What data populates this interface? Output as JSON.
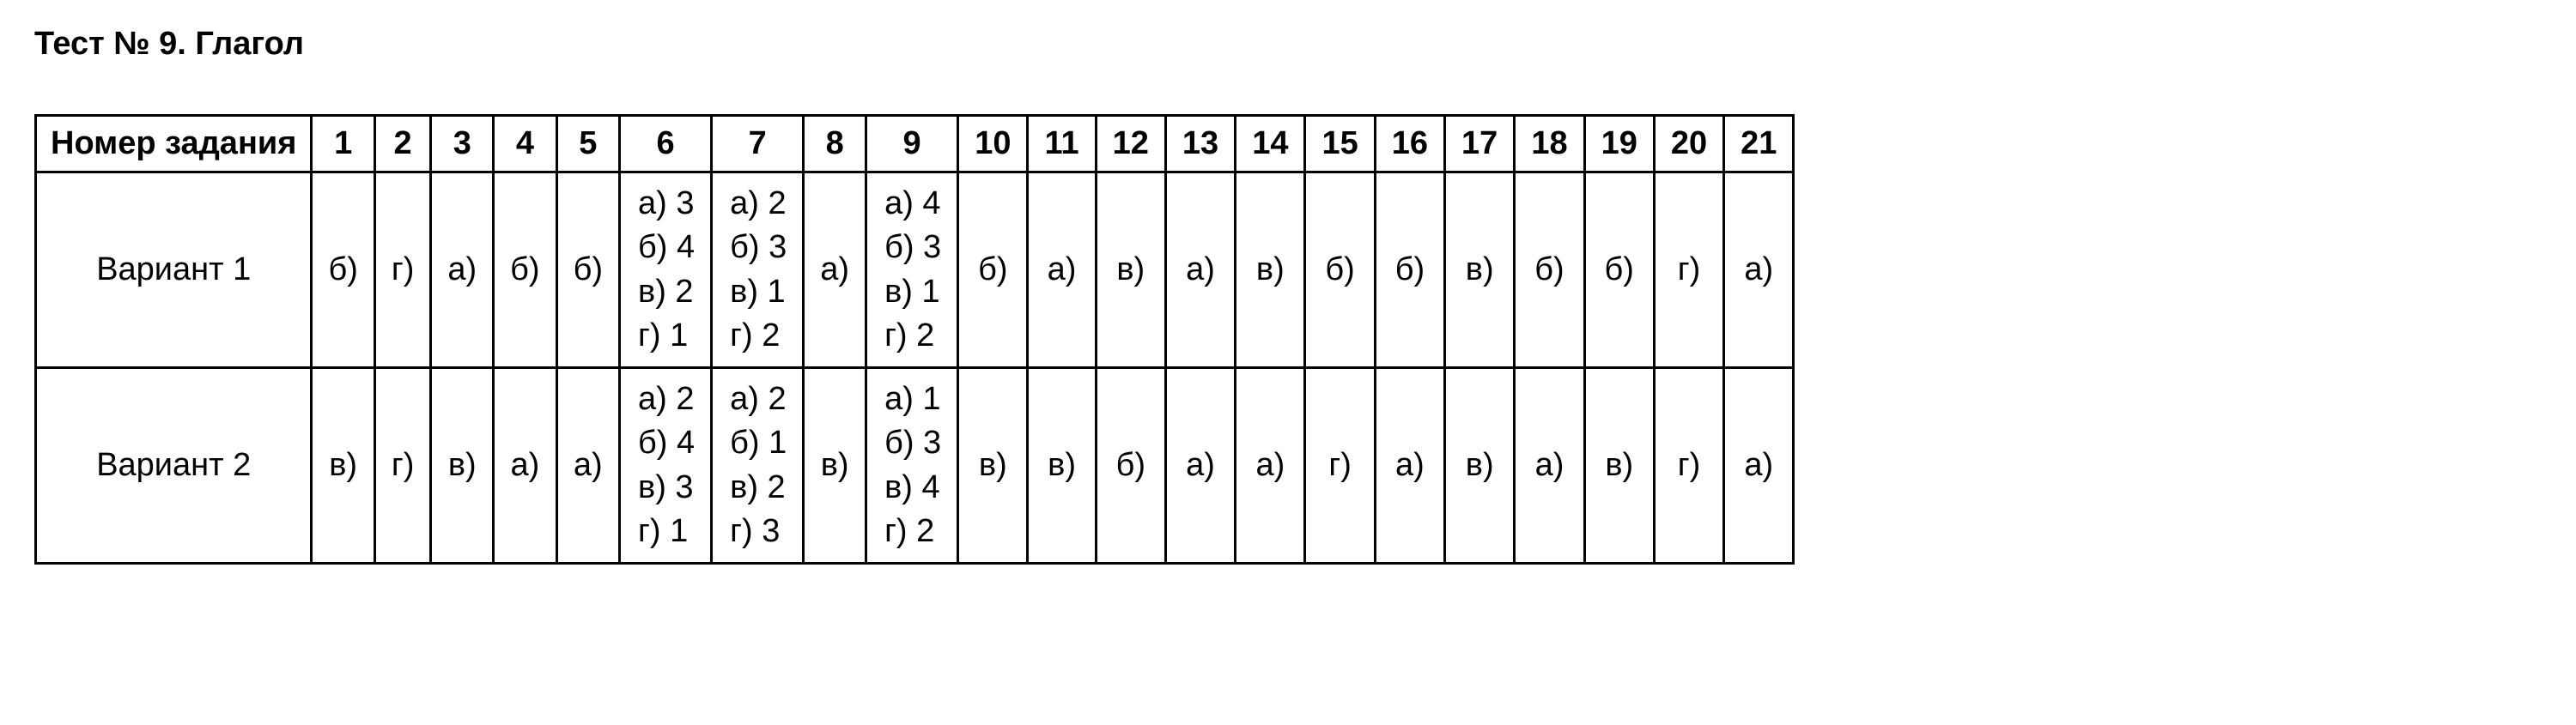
{
  "title": "Тест № 9. Глагол",
  "header_label": "Номер задания",
  "columns": [
    "1",
    "2",
    "3",
    "4",
    "5",
    "6",
    "7",
    "8",
    "9",
    "10",
    "11",
    "12",
    "13",
    "14",
    "15",
    "16",
    "17",
    "18",
    "19",
    "20",
    "21"
  ],
  "rows": [
    {
      "label": "Вариант 1",
      "cells": [
        {
          "type": "single",
          "value": "б)"
        },
        {
          "type": "single",
          "value": "г)"
        },
        {
          "type": "single",
          "value": "а)"
        },
        {
          "type": "single",
          "value": "б)"
        },
        {
          "type": "single",
          "value": "б)"
        },
        {
          "type": "multi",
          "lines": [
            "а) 3",
            "б) 4",
            "в) 2",
            "г) 1"
          ]
        },
        {
          "type": "multi",
          "lines": [
            "а) 2",
            "б) 3",
            "в) 1",
            "г) 2"
          ]
        },
        {
          "type": "single",
          "value": "а)"
        },
        {
          "type": "multi",
          "lines": [
            "а) 4",
            "б) 3",
            "в) 1",
            "г) 2"
          ]
        },
        {
          "type": "single",
          "value": "б)"
        },
        {
          "type": "single",
          "value": "а)"
        },
        {
          "type": "single",
          "value": "в)"
        },
        {
          "type": "single",
          "value": "а)"
        },
        {
          "type": "single",
          "value": "в)"
        },
        {
          "type": "single",
          "value": "б)"
        },
        {
          "type": "single",
          "value": "б)"
        },
        {
          "type": "single",
          "value": "в)"
        },
        {
          "type": "single",
          "value": "б)"
        },
        {
          "type": "single",
          "value": "б)"
        },
        {
          "type": "single",
          "value": "г)"
        },
        {
          "type": "single",
          "value": "а)"
        }
      ]
    },
    {
      "label": "Вариант 2",
      "cells": [
        {
          "type": "single",
          "value": "в)"
        },
        {
          "type": "single",
          "value": "г)"
        },
        {
          "type": "single",
          "value": "в)"
        },
        {
          "type": "single",
          "value": "а)"
        },
        {
          "type": "single",
          "value": "а)"
        },
        {
          "type": "multi",
          "lines": [
            "а) 2",
            "б) 4",
            "в) 3",
            "г) 1"
          ]
        },
        {
          "type": "multi",
          "lines": [
            "а) 2",
            "б) 1",
            "в) 2",
            "г) 3"
          ]
        },
        {
          "type": "single",
          "value": "в)"
        },
        {
          "type": "multi",
          "lines": [
            "а) 1",
            "б) 3",
            "в) 4",
            "г) 2"
          ]
        },
        {
          "type": "single",
          "value": "в)"
        },
        {
          "type": "single",
          "value": "в)"
        },
        {
          "type": "single",
          "value": "б)"
        },
        {
          "type": "single",
          "value": "а)"
        },
        {
          "type": "single",
          "value": "а)"
        },
        {
          "type": "single",
          "value": "г)"
        },
        {
          "type": "single",
          "value": "а)"
        },
        {
          "type": "single",
          "value": "в)"
        },
        {
          "type": "single",
          "value": "а)"
        },
        {
          "type": "single",
          "value": "в)"
        },
        {
          "type": "single",
          "value": "г)"
        },
        {
          "type": "single",
          "value": "а)"
        }
      ]
    }
  ]
}
